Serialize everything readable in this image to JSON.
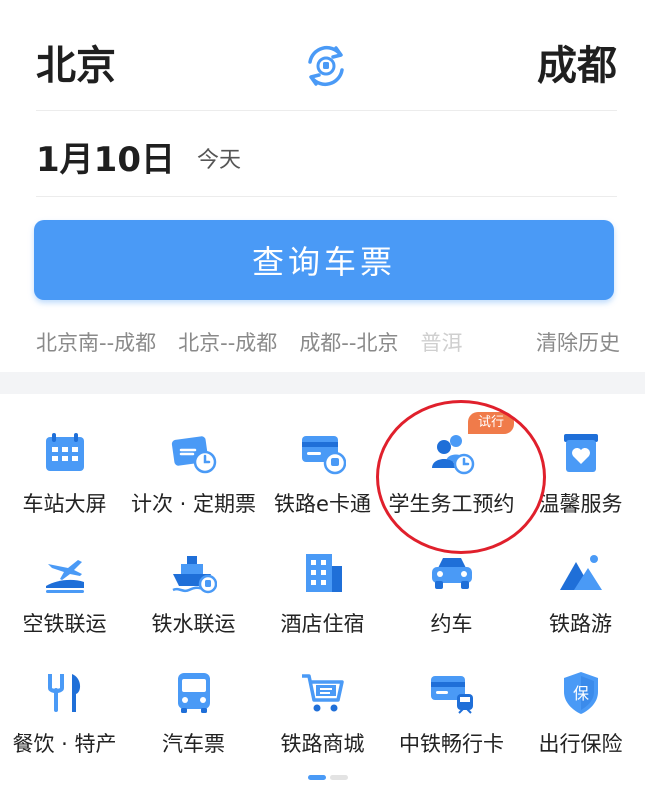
{
  "trip": {
    "from_city": "北京",
    "to_city": "成都",
    "date": "1月10日",
    "date_hint": "今天",
    "query_label": "查询车票"
  },
  "history": {
    "items": [
      "北京南--成都",
      "北京--成都",
      "成都--北京"
    ],
    "faded": "普洱",
    "clear_label": "清除历史"
  },
  "services": [
    {
      "label": "车站大屏",
      "icon": "calendar-icon"
    },
    {
      "label": "计次 · 定期票",
      "icon": "ticket-clock-icon"
    },
    {
      "label": "铁路e卡通",
      "icon": "card-train-icon"
    },
    {
      "label": "学生务工预约",
      "icon": "people-clock-icon"
    },
    {
      "label": "温馨服务",
      "icon": "heart-box-icon"
    },
    {
      "label": "空铁联运",
      "icon": "plane-train-icon"
    },
    {
      "label": "铁水联运",
      "icon": "ship-icon"
    },
    {
      "label": "酒店住宿",
      "icon": "building-icon"
    },
    {
      "label": "约车",
      "icon": "car-icon"
    },
    {
      "label": "铁路游",
      "icon": "mountain-icon"
    },
    {
      "label": "餐饮 · 特产",
      "icon": "fork-knife-icon"
    },
    {
      "label": "汽车票",
      "icon": "bus-icon"
    },
    {
      "label": "铁路商城",
      "icon": "cart-icon"
    },
    {
      "label": "中铁畅行卡",
      "icon": "card-train-2-icon"
    },
    {
      "label": "出行保险",
      "icon": "shield-icon"
    }
  ],
  "badge_label": "试行",
  "colors": {
    "accent": "#4a9af6",
    "badge": "#f07b4a",
    "annotation": "#e0202c",
    "icon_dark": "#1f6fd8"
  }
}
